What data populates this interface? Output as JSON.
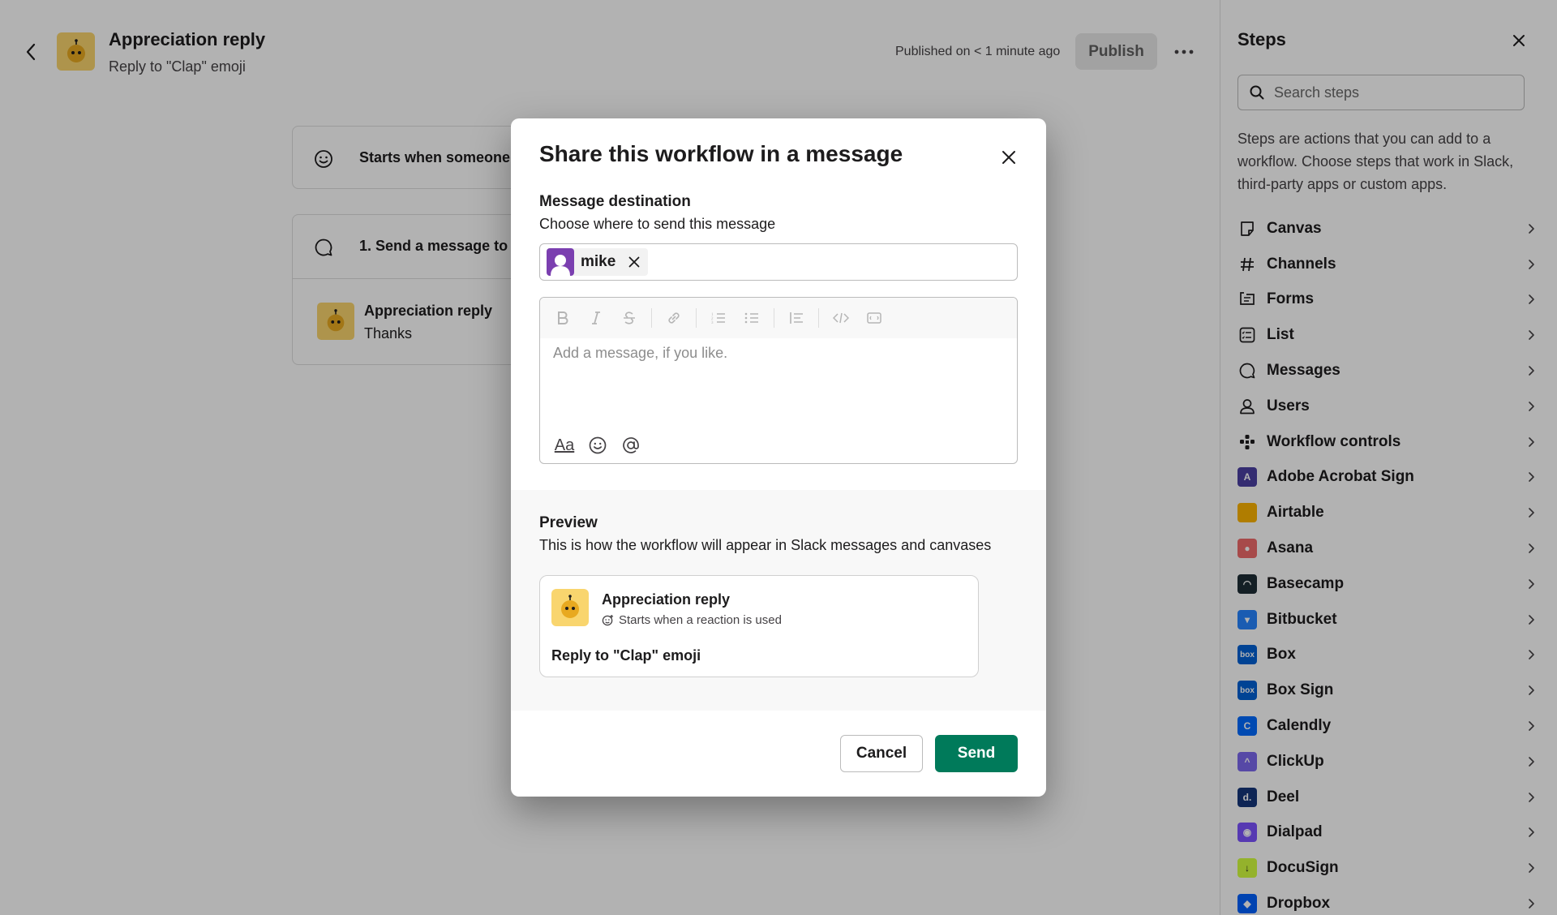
{
  "header": {
    "title": "Appreciation reply",
    "subtitle": "Reply to \"Clap\" emoji",
    "published_status": "Published on < 1 minute ago",
    "publish_label": "Publish"
  },
  "canvas": {
    "trigger_text": "Starts when someone",
    "step_text": "1. Send a message to",
    "message_sender": "Appreciation reply",
    "message_body": "Thanks"
  },
  "steps_panel": {
    "title": "Steps",
    "search_placeholder": "Search steps",
    "description": "Steps are actions that you can add to a workflow. Choose steps that work in Slack, third-party apps or custom apps.",
    "items": [
      {
        "label": "Canvas",
        "icon": "canvas-icon"
      },
      {
        "label": "Channels",
        "icon": "hash-icon"
      },
      {
        "label": "Forms",
        "icon": "form-icon"
      },
      {
        "label": "List",
        "icon": "list-icon"
      },
      {
        "label": "Messages",
        "icon": "message-icon"
      },
      {
        "label": "Users",
        "icon": "user-icon"
      },
      {
        "label": "Workflow controls",
        "icon": "workflow-controls-icon"
      },
      {
        "label": "Adobe Acrobat Sign",
        "icon": "adobe-acrobat-sign-icon",
        "color": "#4b3fa3"
      },
      {
        "label": "Airtable",
        "icon": "airtable-icon",
        "color": "#fcb400"
      },
      {
        "label": "Asana",
        "icon": "asana-icon",
        "color": "#f06a6a"
      },
      {
        "label": "Basecamp",
        "icon": "basecamp-icon",
        "color": "#1d2d35"
      },
      {
        "label": "Bitbucket",
        "icon": "bitbucket-icon",
        "color": "#2684ff"
      },
      {
        "label": "Box",
        "icon": "box-icon",
        "color": "#0061d5"
      },
      {
        "label": "Box Sign",
        "icon": "box-sign-icon",
        "color": "#0061d5"
      },
      {
        "label": "Calendly",
        "icon": "calendly-icon",
        "color": "#006bff"
      },
      {
        "label": "ClickUp",
        "icon": "clickup-icon",
        "color": "#7b68ee"
      },
      {
        "label": "Deel",
        "icon": "deel-icon",
        "color": "#15357a"
      },
      {
        "label": "Dialpad",
        "icon": "dialpad-icon",
        "color": "#7c52ff"
      },
      {
        "label": "DocuSign",
        "icon": "docusign-icon",
        "color": "#d5ff3f"
      },
      {
        "label": "Dropbox",
        "icon": "dropbox-icon",
        "color": "#0061fe"
      }
    ]
  },
  "modal": {
    "title": "Share this workflow in a message",
    "destination_label": "Message destination",
    "destination_help": "Choose where to send this message",
    "recipient": "mike",
    "message_placeholder": "Add a message, if you like.",
    "format_label": "Aa",
    "preview_label": "Preview",
    "preview_help": "This is how the workflow will appear in Slack messages and canvases",
    "preview_card": {
      "name": "Appreciation reply",
      "trigger": "Starts when a reaction is used",
      "description": "Reply to \"Clap\" emoji"
    },
    "cancel_label": "Cancel",
    "send_label": "Send"
  },
  "colors": {
    "send_button": "#007a5a",
    "overlay": "rgba(0,0,0,0.3)",
    "recipient_avatar": "#7b3fb0",
    "bot_avatar": "#f9d56e"
  }
}
